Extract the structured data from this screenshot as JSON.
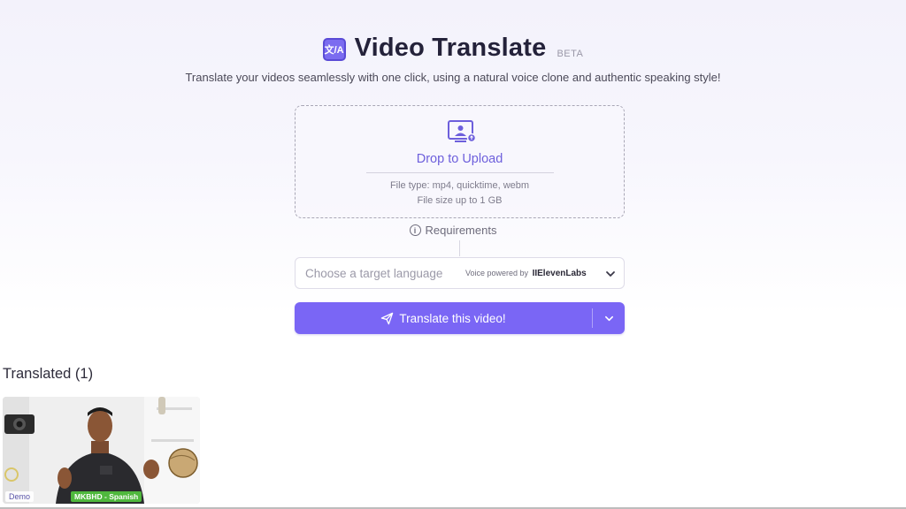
{
  "header": {
    "logo_text": "文/A",
    "title": "Video Translate",
    "badge": "BETA",
    "subtitle": "Translate your videos seamlessly with one click, using a natural voice clone and authentic speaking style!"
  },
  "upload": {
    "icon": "video-upload-icon",
    "label": "Drop to Upload",
    "file_type": "File type: mp4, quicktime, webm",
    "file_size": "File size up to 1 GB"
  },
  "requirements": {
    "icon": "info-icon",
    "label": "Requirements"
  },
  "language_select": {
    "placeholder": "Choose a target language",
    "powered_prefix": "Voice powered by",
    "powered_brand": "IIElevenLabs",
    "icon": "chevron-down-icon"
  },
  "translate_button": {
    "icon": "send-icon",
    "label": "Translate this video!",
    "dropdown_icon": "chevron-down-icon"
  },
  "translated": {
    "heading": "Translated (1)",
    "items": [
      {
        "demo_label": "Demo",
        "language_label": "MKBHD - Spanish"
      }
    ]
  },
  "colors": {
    "accent": "#7a66f5",
    "accent_text": "#6d5fdc",
    "badge_green": "#4fb83d"
  }
}
